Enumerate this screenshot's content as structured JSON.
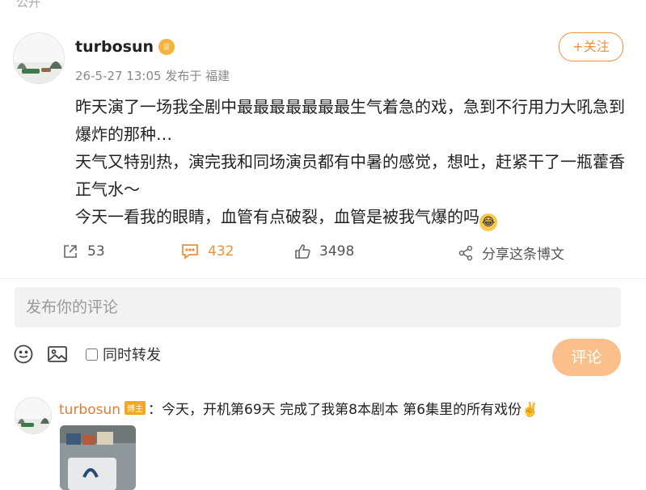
{
  "top_cut_text": "公开",
  "post": {
    "author": "turbosun",
    "author_badge": "♕",
    "date": "26-5-27 13:05",
    "source": "发布于 福建",
    "follow_label": "+关注",
    "content_lines": [
      "昨天演了一场我全剧中最最最最最最最生气着急的戏，急到不行用力大吼急到爆炸的那种…",
      "天气又特别热，演完我和同场演员都有中暑的感觉，想吐，赶紧干了一瓶藿香正气水～",
      "今天一看我的眼睛，血管有点破裂，血管是被我气爆的吗"
    ],
    "reposts": "53",
    "comments": "432",
    "likes": "3498",
    "share_label": "分享这条博文"
  },
  "composer": {
    "placeholder": "发布你的评论",
    "repost_label": "同时转发",
    "submit_label": "评论"
  },
  "reply": {
    "author": "turbosun",
    "tag": "博主",
    "text": "：今天，开机第69天 完成了我第8本剧本 第6集里的所有戏份"
  },
  "colors": {
    "accent": "#f0903a",
    "submit_bg": "#fbbf8c",
    "input_bg": "#f2f2f2"
  }
}
